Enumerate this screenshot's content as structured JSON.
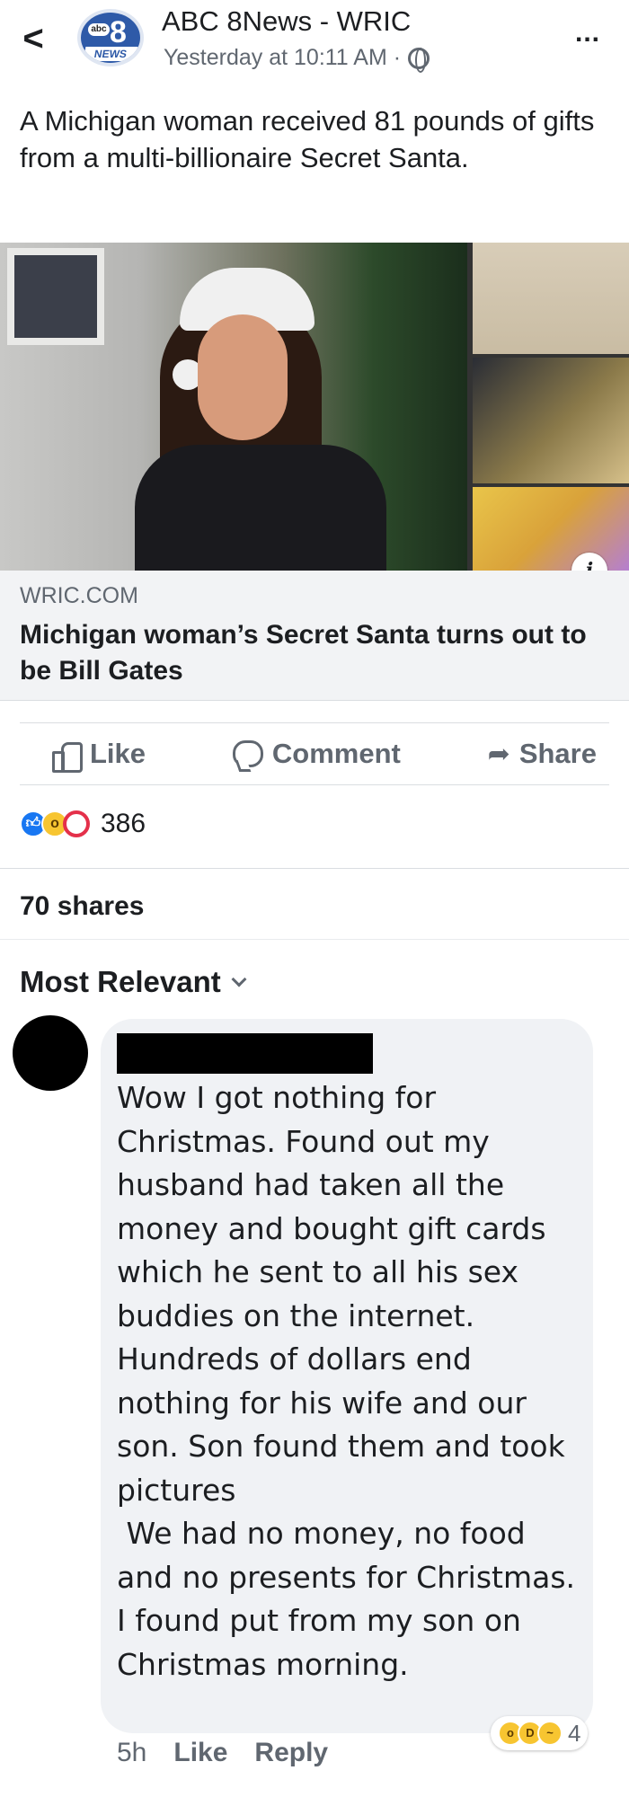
{
  "header": {
    "back_glyph": "<",
    "logo": {
      "abc": "abc",
      "number": "8",
      "news": "NEWS"
    },
    "page_name": "ABC 8News - WRIC",
    "timestamp": "Yesterday at 10:11 AM ·",
    "privacy_icon": "globe-icon",
    "more_glyph": "..."
  },
  "post": {
    "text": "A Michigan woman received 81 pounds of gifts from a multi-billionaire Secret Santa."
  },
  "link": {
    "info_glyph": "i",
    "domain": "WRIC.COM",
    "title": "Michigan woman’s Secret Santa turns out to be Bill Gates"
  },
  "actions": {
    "like": "Like",
    "comment": "Comment",
    "share": "Share"
  },
  "reactions": {
    "icons": [
      "like-reaction-icon",
      "wow-reaction-icon",
      "love-reaction-icon"
    ],
    "count": "386"
  },
  "shares": "70 shares",
  "sort": {
    "label": "Most Relevant"
  },
  "comment": {
    "text": "Wow I got nothing for Christmas. Found out my husband had taken all the money and bought gift cards which he sent to all his sex buddies on the internet. Hundreds of dollars end nothing for his wife and our son. Son found them and took pictures\n We had no money, no food and no presents for Christmas. I found put from my son on Christmas morning.",
    "time": "5h",
    "like": "Like",
    "reply": "Reply",
    "reaction_icons": [
      "wow-reaction-icon",
      "haha-reaction-icon",
      "sad-reaction-icon"
    ],
    "reaction_count": "4"
  },
  "colors": {
    "link_caption_bg": "#f2f3f5",
    "comment_bubble_bg": "#f0f2f5",
    "secondary_text": "#606770",
    "like_blue": "#1877f2",
    "love_red": "#e4304a",
    "wow_yellow": "#f7c531"
  }
}
